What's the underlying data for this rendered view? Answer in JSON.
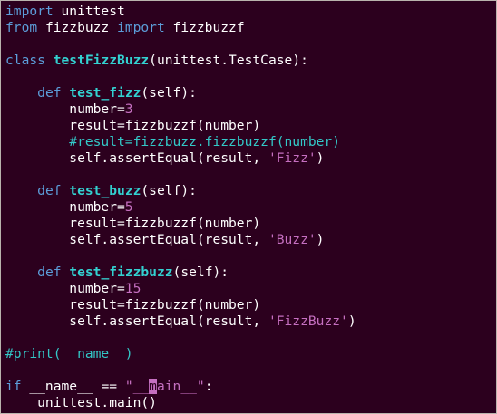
{
  "editor": {
    "lines": [
      [
        {
          "t": "import",
          "c": "kw"
        },
        {
          "t": " unittest",
          "c": "plain"
        }
      ],
      [
        {
          "t": "from",
          "c": "kw"
        },
        {
          "t": " fizzbuzz ",
          "c": "plain"
        },
        {
          "t": "import",
          "c": "kw"
        },
        {
          "t": " fizzbuzzf",
          "c": "plain"
        }
      ],
      [],
      [
        {
          "t": "class",
          "c": "kw"
        },
        {
          "t": " ",
          "c": "plain"
        },
        {
          "t": "testFizzBuzz",
          "c": "fn"
        },
        {
          "t": "(unittest.TestCase):",
          "c": "plain"
        }
      ],
      [],
      [
        {
          "t": "    ",
          "c": "plain"
        },
        {
          "t": "def",
          "c": "kw"
        },
        {
          "t": " ",
          "c": "plain"
        },
        {
          "t": "test_fizz",
          "c": "fn"
        },
        {
          "t": "(self):",
          "c": "plain"
        }
      ],
      [
        {
          "t": "        number=",
          "c": "plain"
        },
        {
          "t": "3",
          "c": "num"
        }
      ],
      [
        {
          "t": "        result=fizzbuzzf(number)",
          "c": "plain"
        }
      ],
      [
        {
          "t": "        #result=fizzbuzz.fizzbuzzf(number)",
          "c": "comment"
        }
      ],
      [
        {
          "t": "        self.assertEqual(result, ",
          "c": "plain"
        },
        {
          "t": "'Fizz'",
          "c": "str"
        },
        {
          "t": ")",
          "c": "plain"
        }
      ],
      [],
      [
        {
          "t": "    ",
          "c": "plain"
        },
        {
          "t": "def",
          "c": "kw"
        },
        {
          "t": " ",
          "c": "plain"
        },
        {
          "t": "test_buzz",
          "c": "fn"
        },
        {
          "t": "(self):",
          "c": "plain"
        }
      ],
      [
        {
          "t": "        number=",
          "c": "plain"
        },
        {
          "t": "5",
          "c": "num"
        }
      ],
      [
        {
          "t": "        result=fizzbuzzf(number)",
          "c": "plain"
        }
      ],
      [
        {
          "t": "        self.assertEqual(result, ",
          "c": "plain"
        },
        {
          "t": "'Buzz'",
          "c": "str"
        },
        {
          "t": ")",
          "c": "plain"
        }
      ],
      [],
      [
        {
          "t": "    ",
          "c": "plain"
        },
        {
          "t": "def",
          "c": "kw"
        },
        {
          "t": " ",
          "c": "plain"
        },
        {
          "t": "test_fizzbuzz",
          "c": "fn"
        },
        {
          "t": "(self):",
          "c": "plain"
        }
      ],
      [
        {
          "t": "        number=",
          "c": "plain"
        },
        {
          "t": "15",
          "c": "num"
        }
      ],
      [
        {
          "t": "        result=fizzbuzzf(number)",
          "c": "plain"
        }
      ],
      [
        {
          "t": "        self.assertEqual(result, ",
          "c": "plain"
        },
        {
          "t": "'FizzBuzz'",
          "c": "str"
        },
        {
          "t": ")",
          "c": "plain"
        }
      ],
      [],
      [
        {
          "t": "#print(__name__)",
          "c": "comment"
        }
      ],
      [],
      [
        {
          "t": "if",
          "c": "kw"
        },
        {
          "t": " __name__ == ",
          "c": "plain"
        },
        {
          "t": "\"__",
          "c": "str"
        },
        {
          "t": "m",
          "c": "cursor"
        },
        {
          "t": "ain__\"",
          "c": "str"
        },
        {
          "t": ":",
          "c": "plain"
        }
      ],
      [
        {
          "t": "    unittest.main()",
          "c": "plain"
        }
      ]
    ]
  },
  "colors": {
    "background": "#2c001e",
    "keyword": "#5c9dd9",
    "function_name": "#33d1d1",
    "literal": "#c56fc0",
    "comment": "#33c8c8",
    "text": "#ffffff"
  }
}
